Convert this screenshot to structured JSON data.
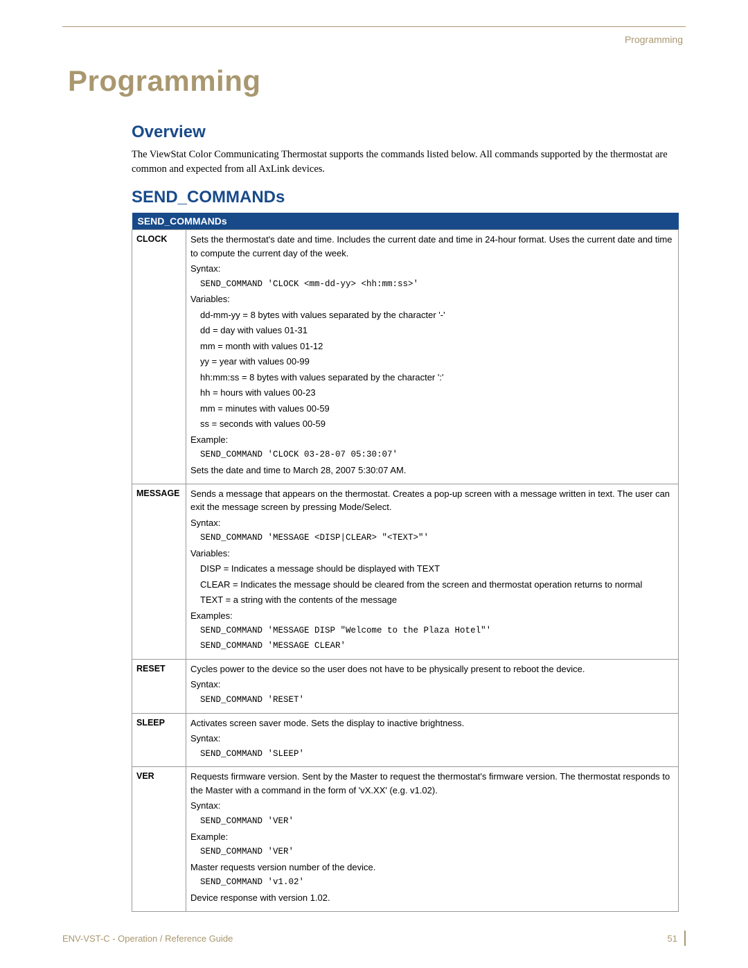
{
  "header": {
    "breadcrumb": "Programming"
  },
  "title": "Programming",
  "overview": {
    "heading": "Overview",
    "text": "The ViewStat Color Communicating Thermostat supports the commands listed below. All commands supported by the thermostat are common and expected from all AxLink devices."
  },
  "send_commands": {
    "heading": "SEND_COMMANDs",
    "table_header": "SEND_COMMANDs",
    "rows": {
      "clock": {
        "name": "CLOCK",
        "desc": "Sets the thermostat's date and time. Includes the current date and time in 24-hour format. Uses the current date and time to compute the current day of the week.",
        "syntax_label": "Syntax:",
        "syntax_code": "SEND_COMMAND 'CLOCK <mm-dd-yy> <hh:mm:ss>'",
        "vars_label": "Variables:",
        "v1": "dd-mm-yy = 8 bytes with values separated by the character '-'",
        "v2": "dd = day with values 01-31",
        "v3": "mm = month with values 01-12",
        "v4": "yy = year with values 00-99",
        "v5": "hh:mm:ss = 8 bytes with values separated by the character ':'",
        "v6": "hh = hours with values 00-23",
        "v7": "mm = minutes with values 00-59",
        "v8": "ss = seconds with values 00-59",
        "ex_label": "Example:",
        "ex_code": "SEND_COMMAND 'CLOCK 03-28-07 05:30:07'",
        "ex_result": "Sets the date and time to March 28, 2007 5:30:07 AM."
      },
      "message": {
        "name": "MESSAGE",
        "desc": "Sends a message that appears on the thermostat. Creates a pop-up screen with a message written in text. The user can exit the message screen by pressing Mode/Select.",
        "syntax_label": "Syntax:",
        "syntax_code": "SEND_COMMAND 'MESSAGE <DISP|CLEAR> \"<TEXT>\"'",
        "vars_label": "Variables:",
        "v1": "DISP = Indicates a message should be displayed with TEXT",
        "v2": "CLEAR = Indicates the message should be cleared from the screen and thermostat operation returns to normal",
        "v3": "TEXT = a string with the contents of the message",
        "ex_label": "Examples:",
        "ex_code1": "SEND_COMMAND 'MESSAGE DISP \"Welcome to the Plaza Hotel\"'",
        "ex_code2": "SEND_COMMAND 'MESSAGE CLEAR'"
      },
      "reset": {
        "name": "RESET",
        "desc": "Cycles power to the device so the user does not have to be physically present to reboot the device.",
        "syntax_label": "Syntax:",
        "syntax_code": "SEND_COMMAND 'RESET'"
      },
      "sleep": {
        "name": "SLEEP",
        "desc": "Activates screen saver mode. Sets the display to inactive brightness.",
        "syntax_label": "Syntax:",
        "syntax_code": "SEND_COMMAND 'SLEEP'"
      },
      "ver": {
        "name": "VER",
        "desc": "Requests firmware version. Sent by the Master to request the thermostat's firmware version. The thermostat responds to the Master with a command in the form of 'vX.XX' (e.g. v1.02).",
        "syntax_label": "Syntax:",
        "syntax_code": "SEND_COMMAND 'VER'",
        "ex_label": "Example:",
        "ex_code": "SEND_COMMAND 'VER'",
        "ex_result1": "Master requests version number of the device.",
        "ex_code2": "SEND_COMMAND 'v1.02'",
        "ex_result2": "Device response with version 1.02."
      }
    }
  },
  "footer": {
    "left": "ENV-VST-C - Operation / Reference Guide",
    "page": "51"
  }
}
